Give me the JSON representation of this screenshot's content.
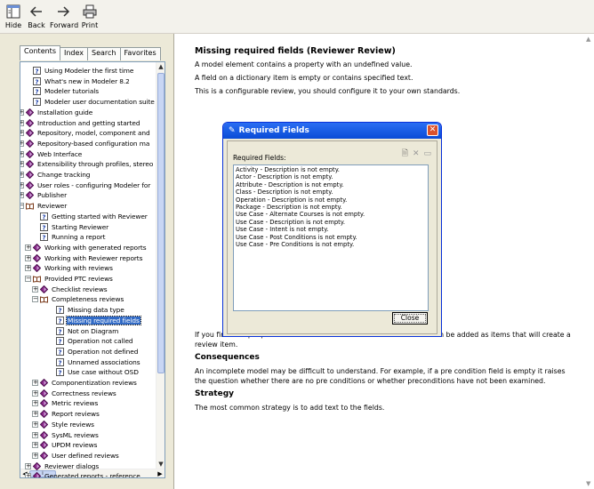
{
  "toolbar": {
    "buttons": [
      {
        "label": "Hide",
        "icon": "hide-icon"
      },
      {
        "label": "Back",
        "icon": "back-arrow-icon"
      },
      {
        "label": "Forward",
        "icon": "forward-arrow-icon"
      },
      {
        "label": "Print",
        "icon": "printer-icon"
      }
    ]
  },
  "nav": {
    "tabs": [
      "Contents",
      "Index",
      "Search",
      "Favorites"
    ],
    "active_tab": "Contents"
  },
  "tree": [
    {
      "label": "Using Modeler the first time",
      "type": "page",
      "level": 1
    },
    {
      "label": "What's new in Modeler 8.2",
      "type": "page",
      "level": 1
    },
    {
      "label": "Modeler tutorials",
      "type": "page",
      "level": 1
    },
    {
      "label": "Modeler user documentation suite",
      "type": "page",
      "level": 1
    },
    {
      "label": "Installation guide",
      "type": "book",
      "level": 0
    },
    {
      "label": "Introduction and getting started",
      "type": "book",
      "level": 0
    },
    {
      "label": "Repository, model, component and",
      "type": "book",
      "level": 0
    },
    {
      "label": "Repository-based configuration ma",
      "type": "book",
      "level": 0
    },
    {
      "label": "Web Interface",
      "type": "book",
      "level": 0
    },
    {
      "label": "Extensibility through profiles, stereo",
      "type": "book",
      "level": 0
    },
    {
      "label": "Change tracking",
      "type": "book",
      "level": 0
    },
    {
      "label": "User roles - configuring Modeler for",
      "type": "book",
      "level": 0
    },
    {
      "label": "Publisher",
      "type": "book",
      "level": 0
    },
    {
      "label": "Reviewer",
      "type": "open-book",
      "level": 0
    },
    {
      "label": "Getting started with Reviewer",
      "type": "page",
      "level": 2
    },
    {
      "label": "Starting Reviewer",
      "type": "page",
      "level": 2
    },
    {
      "label": "Running a report",
      "type": "page",
      "level": 2
    },
    {
      "label": "Working with generated reports",
      "type": "book",
      "level": 1
    },
    {
      "label": "Working with Reviewer reports",
      "type": "book",
      "level": 1
    },
    {
      "label": "Working with reviews",
      "type": "book",
      "level": 1
    },
    {
      "label": "Provided PTC reviews",
      "type": "open-book",
      "level": 1
    },
    {
      "label": "Checklist reviews",
      "type": "book",
      "level": 2
    },
    {
      "label": "Completeness reviews",
      "type": "open-book",
      "level": 2
    },
    {
      "label": "Missing data type",
      "type": "page",
      "level": 4
    },
    {
      "label": "Missing required fields",
      "type": "page",
      "level": 4,
      "selected": true
    },
    {
      "label": "Not on Diagram",
      "type": "page",
      "level": 4
    },
    {
      "label": "Operation not called",
      "type": "page",
      "level": 4
    },
    {
      "label": "Operation not defined",
      "type": "page",
      "level": 4
    },
    {
      "label": "Unnamed associations",
      "type": "page",
      "level": 4
    },
    {
      "label": "Use case without OSD",
      "type": "page",
      "level": 4
    },
    {
      "label": "Componentization reviews",
      "type": "book",
      "level": 2
    },
    {
      "label": "Correctness reviews",
      "type": "book",
      "level": 2
    },
    {
      "label": "Metric reviews",
      "type": "book",
      "level": 2
    },
    {
      "label": "Report reviews",
      "type": "book",
      "level": 2
    },
    {
      "label": "Style reviews",
      "type": "book",
      "level": 2
    },
    {
      "label": "SysML reviews",
      "type": "book",
      "level": 2
    },
    {
      "label": "UPDM reviews",
      "type": "book",
      "level": 2
    },
    {
      "label": "User defined reviews",
      "type": "book",
      "level": 2
    },
    {
      "label": "Reviewer dialogs",
      "type": "book",
      "level": 1
    },
    {
      "label": "Generated reports - reference",
      "type": "book",
      "level": 1
    }
  ],
  "article": {
    "title": "Missing required fields (Reviewer Review)",
    "intro": [
      "A model element contains a property with an undefined value.",
      "A field on a dictionary item is empty or contains specified text.",
      "This is a configurable review, you should configure it to your own standards."
    ],
    "after_image": "If you find that people often use text like \"todo\" or \"tbd\" then these can be added as items that will create a review item.",
    "consequences_heading": "Consequences",
    "consequences": "An incomplete model may be difficult to understand. For example, if a pre condition field is empty it raises the question whether there are no pre conditions or whether preconditions have not been examined.",
    "strategy_heading": "Strategy",
    "strategy": "The most common strategy is to add text to the fields."
  },
  "dialog": {
    "title": "Required Fields",
    "label": "Required Fields:",
    "items": [
      "Activity - Description is not empty.",
      "Actor - Description is not empty.",
      "Attribute - Description is not empty.",
      "Class - Description is not empty.",
      "Operation - Description is not empty.",
      "Package - Description is not empty.",
      "Use Case - Alternate Courses is not empty.",
      "Use Case - Description is not empty.",
      "Use Case - Intent is not empty.",
      "Use Case - Post Conditions is not empty.",
      "Use Case - Pre Conditions is not empty."
    ],
    "close_label": "Close"
  }
}
